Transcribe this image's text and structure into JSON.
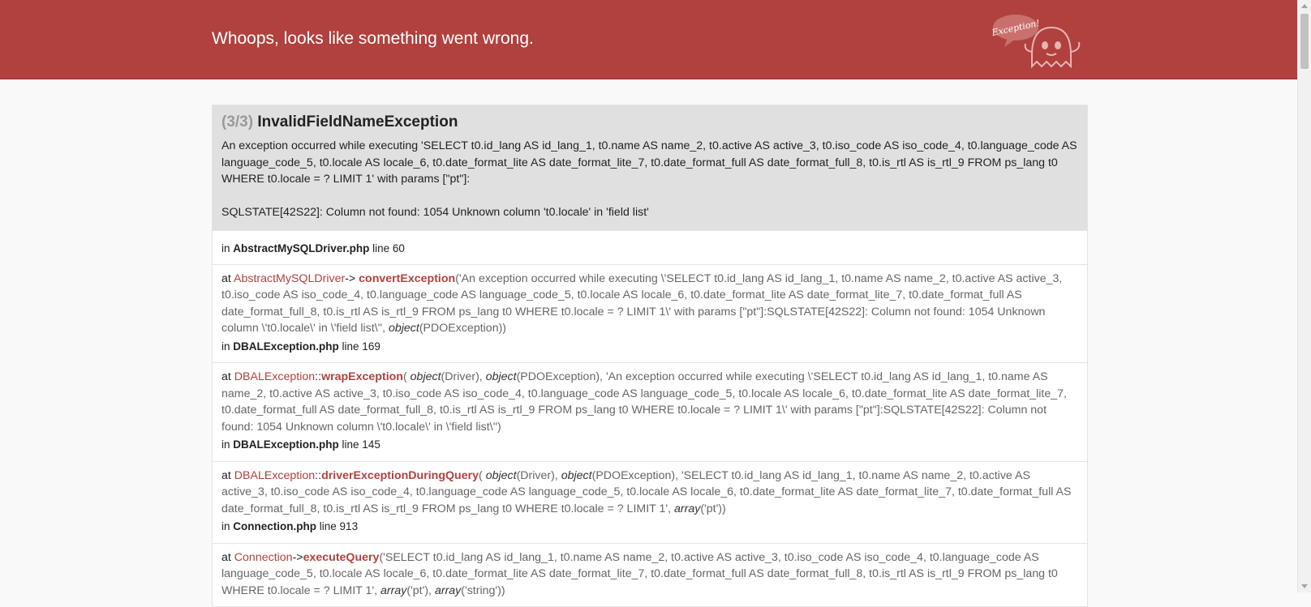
{
  "header": {
    "title": "Whoops, looks like something went wrong.",
    "ghost_bubble_text": "Exception!"
  },
  "exception": {
    "count": "(3/3)",
    "class_name": "InvalidFieldNameException",
    "message_1": "An exception occurred while executing 'SELECT t0.id_lang AS id_lang_1, t0.name AS name_2, t0.active AS active_3, t0.iso_code AS iso_code_4, t0.language_code AS language_code_5, t0.locale AS locale_6, t0.date_format_lite AS date_format_lite_7, t0.date_format_full AS date_format_full_8, t0.is_rtl AS is_rtl_9 FROM ps_lang t0 WHERE t0.locale = ? LIMIT 1' with params [\"pt\"]:",
    "message_2": "SQLSTATE[42S22]: Column not found: 1054 Unknown column 't0.locale' in 'field list'"
  },
  "trace": {
    "first": {
      "in_label": "in",
      "file": "AbstractMySQLDriver.php",
      "line": "line 60"
    },
    "items": [
      {
        "at": "at",
        "class": "AbstractMySQLDriver",
        "sep": "->",
        "fn": "convertException",
        "args": "('An exception occurred while executing \\'SELECT t0.id_lang AS id_lang_1, t0.name AS name_2, t0.active AS active_3, t0.iso_code AS iso_code_4, t0.language_code AS language_code_5, t0.locale AS locale_6, t0.date_format_lite AS date_format_lite_7, t0.date_format_full AS date_format_full_8, t0.is_rtl AS is_rtl_9 FROM ps_lang t0 WHERE t0.locale = ? LIMIT 1\\' with params [\"pt\"]:SQLSTATE[42S22]: Column not found: 1054 Unknown column \\'t0.locale\\' in \\'field list\\'', ",
        "args_obj": "object",
        "args_tail": "(PDOException))",
        "in_label": "in",
        "file": "DBALException.php",
        "line": "line 169"
      },
      {
        "at": "at",
        "class": "DBALException",
        "sep": "::",
        "fn": "wrapException",
        "args_pre_obj1": "(",
        "obj1": "object",
        "obj1_tail": "(Driver), ",
        "obj2": "object",
        "args": "(PDOException), 'An exception occurred while executing \\'SELECT t0.id_lang AS id_lang_1, t0.name AS name_2, t0.active AS active_3, t0.iso_code AS iso_code_4, t0.language_code AS language_code_5, t0.locale AS locale_6, t0.date_format_lite AS date_format_lite_7, t0.date_format_full AS date_format_full_8, t0.is_rtl AS is_rtl_9 FROM ps_lang t0 WHERE t0.locale = ? LIMIT 1\\' with params [\"pt\"]:SQLSTATE[42S22]: Column not found: 1054 Unknown column \\'t0.locale\\' in \\'field list\\'')",
        "in_label": "in",
        "file": "DBALException.php",
        "line": "line 145"
      },
      {
        "at": "at",
        "class": "DBALException",
        "sep": "::",
        "fn": "driverExceptionDuringQuery",
        "args_pre_obj1": "(",
        "obj1": "object",
        "obj1_tail": "(Driver), ",
        "obj2": "object",
        "args": "(PDOException), 'SELECT t0.id_lang AS id_lang_1, t0.name AS name_2, t0.active AS active_3, t0.iso_code AS iso_code_4, t0.language_code AS language_code_5, t0.locale AS locale_6, t0.date_format_lite AS date_format_lite_7, t0.date_format_full AS date_format_full_8, t0.is_rtl AS is_rtl_9 FROM ps_lang t0 WHERE t0.locale = ? LIMIT 1', ",
        "arr": "array",
        "arr_tail": "('pt'))",
        "in_label": "in",
        "file": "Connection.php",
        "line": "line 913"
      },
      {
        "at": "at",
        "class": "Connection",
        "sep": "->",
        "fn": "executeQuery",
        "args": "('SELECT t0.id_lang AS id_lang_1, t0.name AS name_2, t0.active AS active_3, t0.iso_code AS iso_code_4, t0.language_code AS language_code_5, t0.locale AS locale_6, t0.date_format_lite AS date_format_lite_7, t0.date_format_full AS date_format_full_8, t0.is_rtl AS is_rtl_9 FROM ps_lang t0 WHERE t0.locale = ? LIMIT 1', ",
        "arr": "array",
        "arr_tail": "('pt'), ",
        "arr2": "array",
        "arr2_tail": "('string'))"
      }
    ]
  },
  "colors": {
    "header_bg": "#b0413e",
    "accent": "#b0413e",
    "exception_head_bg": "#e0e0e0"
  }
}
